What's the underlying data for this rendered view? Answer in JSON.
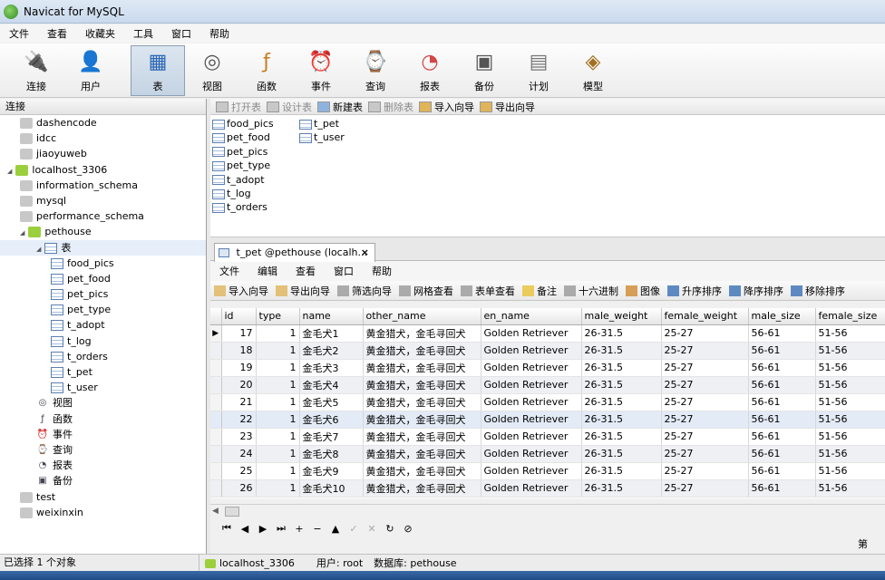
{
  "window": {
    "title": "Navicat for MySQL"
  },
  "menu": [
    "文件",
    "查看",
    "收藏夹",
    "工具",
    "窗口",
    "帮助"
  ],
  "toolbar": [
    {
      "label": "连接",
      "icon": "connection-icon"
    },
    {
      "label": "用户",
      "icon": "user-icon"
    },
    {
      "label": "表",
      "icon": "table-icon"
    },
    {
      "label": "视图",
      "icon": "view-icon"
    },
    {
      "label": "函数",
      "icon": "function-icon"
    },
    {
      "label": "事件",
      "icon": "event-icon"
    },
    {
      "label": "查询",
      "icon": "query-icon"
    },
    {
      "label": "报表",
      "icon": "report-icon"
    },
    {
      "label": "备份",
      "icon": "backup-icon"
    },
    {
      "label": "计划",
      "icon": "schedule-icon"
    },
    {
      "label": "模型",
      "icon": "model-icon"
    }
  ],
  "left": {
    "header": "连接",
    "tree": [
      "dashencode",
      "idcc",
      "jiaoyuweb",
      "localhost_3306",
      "information_schema",
      "mysql",
      "performance_schema",
      "pethouse",
      "表",
      "food_pics",
      "pet_food",
      "pet_pics",
      "pet_type",
      "t_adopt",
      "t_log",
      "t_orders",
      "t_pet",
      "t_user",
      "视图",
      "函数",
      "事件",
      "查询",
      "报表",
      "备份",
      "test",
      "weixinxin"
    ]
  },
  "objects": {
    "toolbar": [
      "打开表",
      "设计表",
      "新建表",
      "删除表",
      "导入向导",
      "导出向导"
    ],
    "tables": [
      "food_pics",
      "pet_food",
      "pet_pics",
      "pet_type",
      "t_adopt",
      "t_log",
      "t_orders",
      "t_pet",
      "t_user"
    ]
  },
  "tab": {
    "title": "t_pet @pethouse (localh...",
    "close": "×"
  },
  "submenu": [
    "文件",
    "编辑",
    "查看",
    "窗口",
    "帮助"
  ],
  "subtoolbar": [
    "导入向导",
    "导出向导",
    "筛选向导",
    "网格查看",
    "表单查看",
    "备注",
    "十六进制",
    "图像",
    "升序排序",
    "降序排序",
    "移除排序"
  ],
  "grid": {
    "columns": [
      "id",
      "type",
      "name",
      "other_name",
      "en_name",
      "male_weight",
      "female_weight",
      "male_size",
      "female_size"
    ],
    "rows": [
      [
        "17",
        "1",
        "金毛犬1",
        "黄金猎犬，金毛寻回犬",
        "Golden Retriever",
        "26-31.5",
        "25-27",
        "56-61",
        "51-56"
      ],
      [
        "18",
        "1",
        "金毛犬2",
        "黄金猎犬，金毛寻回犬",
        "Golden Retriever",
        "26-31.5",
        "25-27",
        "56-61",
        "51-56"
      ],
      [
        "19",
        "1",
        "金毛犬3",
        "黄金猎犬，金毛寻回犬",
        "Golden Retriever",
        "26-31.5",
        "25-27",
        "56-61",
        "51-56"
      ],
      [
        "20",
        "1",
        "金毛犬4",
        "黄金猎犬，金毛寻回犬",
        "Golden Retriever",
        "26-31.5",
        "25-27",
        "56-61",
        "51-56"
      ],
      [
        "21",
        "1",
        "金毛犬5",
        "黄金猎犬，金毛寻回犬",
        "Golden Retriever",
        "26-31.5",
        "25-27",
        "56-61",
        "51-56"
      ],
      [
        "22",
        "1",
        "金毛犬6",
        "黄金猎犬，金毛寻回犬",
        "Golden Retriever",
        "26-31.5",
        "25-27",
        "56-61",
        "51-56"
      ],
      [
        "23",
        "1",
        "金毛犬7",
        "黄金猎犬，金毛寻回犬",
        "Golden Retriever",
        "26-31.5",
        "25-27",
        "56-61",
        "51-56"
      ],
      [
        "24",
        "1",
        "金毛犬8",
        "黄金猎犬，金毛寻回犬",
        "Golden Retriever",
        "26-31.5",
        "25-27",
        "56-61",
        "51-56"
      ],
      [
        "25",
        "1",
        "金毛犬9",
        "黄金猎犬，金毛寻回犬",
        "Golden Retriever",
        "26-31.5",
        "25-27",
        "56-61",
        "51-56"
      ],
      [
        "26",
        "1",
        "金毛犬10",
        "黄金猎犬，金毛寻回犬",
        "Golden Retriever",
        "26-31.5",
        "25-27",
        "56-61",
        "51-56"
      ]
    ]
  },
  "nav": [
    "⏮",
    "◀",
    "▶",
    "⏭",
    "+",
    "−",
    "▲",
    "✓",
    "✕",
    "↻",
    "⊘"
  ],
  "page_indicator": "第",
  "status": {
    "left": "已选择 1 个对象",
    "connection": "localhost_3306",
    "user": "用户: root",
    "database": "数据库: pethouse"
  }
}
